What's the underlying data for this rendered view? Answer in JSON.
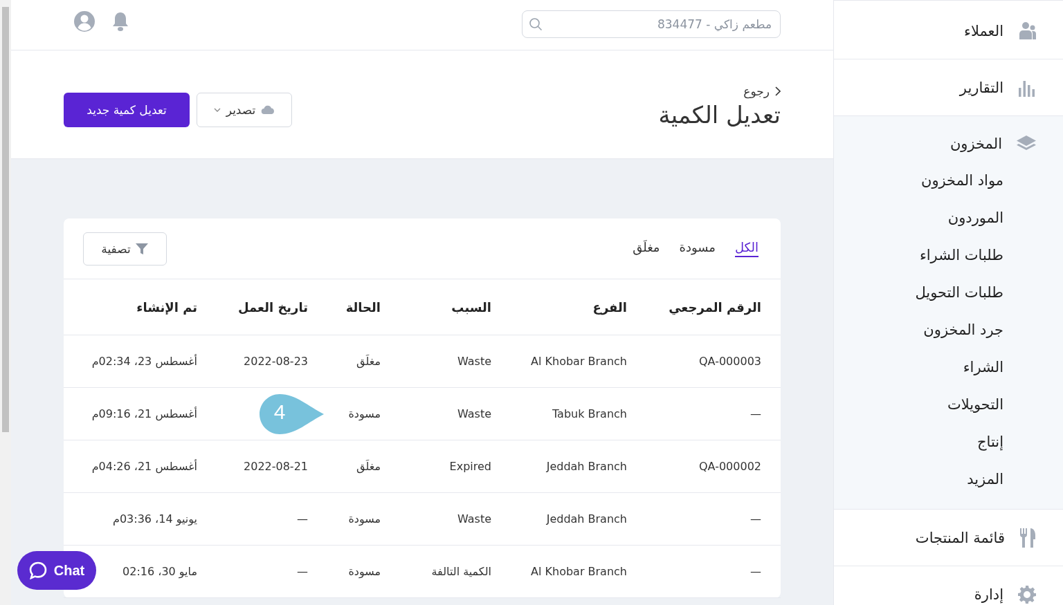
{
  "topbar": {
    "search": {
      "placeholder": "مطعم زاكي - 834477"
    }
  },
  "header": {
    "back_link": "رجوع",
    "title": "تعديل الكمية",
    "export_button": "تصدير",
    "primary_button": "تعديل كمية جديد"
  },
  "card": {
    "tabs": [
      {
        "label": "الكل",
        "selected": true
      },
      {
        "label": "مسودة",
        "selected": false
      },
      {
        "label": "مغلَق",
        "selected": false
      }
    ],
    "filter_button": "تصفية"
  },
  "table": {
    "columns": [
      "الرقم المرجعي",
      "الفرع",
      "السبب",
      "الحالة",
      "تاريخ العمل",
      "تم الإنشاء"
    ],
    "rows": [
      {
        "cells": [
          "QA-000003",
          "Al Khobar Branch",
          "Waste",
          "مغلَق",
          "2022-08-23",
          "أغسطس 23، 02:34م"
        ]
      },
      {
        "cells": [
          "—",
          "Tabuk Branch",
          "Waste",
          "مسودة",
          "",
          "أغسطس 21، 09:16م"
        ]
      },
      {
        "cells": [
          "QA-000002",
          "Jeddah Branch",
          "Expired",
          "مغلَق",
          "2022-08-21",
          "أغسطس 21، 04:26م"
        ]
      },
      {
        "cells": [
          "—",
          "Jeddah Branch",
          "Waste",
          "مسودة",
          "—",
          "يونيو 14، 03:36م"
        ]
      },
      {
        "cells": [
          "—",
          "Al Khobar Branch",
          "الكمية التالفة",
          "مسودة",
          "—",
          "مايو 30، 02:16"
        ]
      }
    ]
  },
  "step_marker": {
    "label": "4"
  },
  "chat_button": "Chat",
  "sidebar": {
    "items": [
      {
        "label": "العملاء",
        "kind": "customers",
        "expanded": false
      },
      {
        "label": "التقارير",
        "kind": "reports",
        "expanded": false
      },
      {
        "label": "المخزون",
        "kind": "inventory",
        "expanded": true,
        "children": [
          {
            "label": "مواد المخزون"
          },
          {
            "label": "الموردون"
          },
          {
            "label": "طلبات الشراء"
          },
          {
            "label": "طلبات التحويل"
          },
          {
            "label": "جرد المخزون"
          },
          {
            "label": "الشراء"
          },
          {
            "label": "التحويلات"
          },
          {
            "label": "إنتاج"
          },
          {
            "label": "المزيد"
          }
        ]
      },
      {
        "label": "قائمة المنتجات",
        "kind": "menu",
        "expanded": false
      },
      {
        "label": "إدارة",
        "kind": "manage",
        "expanded": false
      }
    ]
  }
}
